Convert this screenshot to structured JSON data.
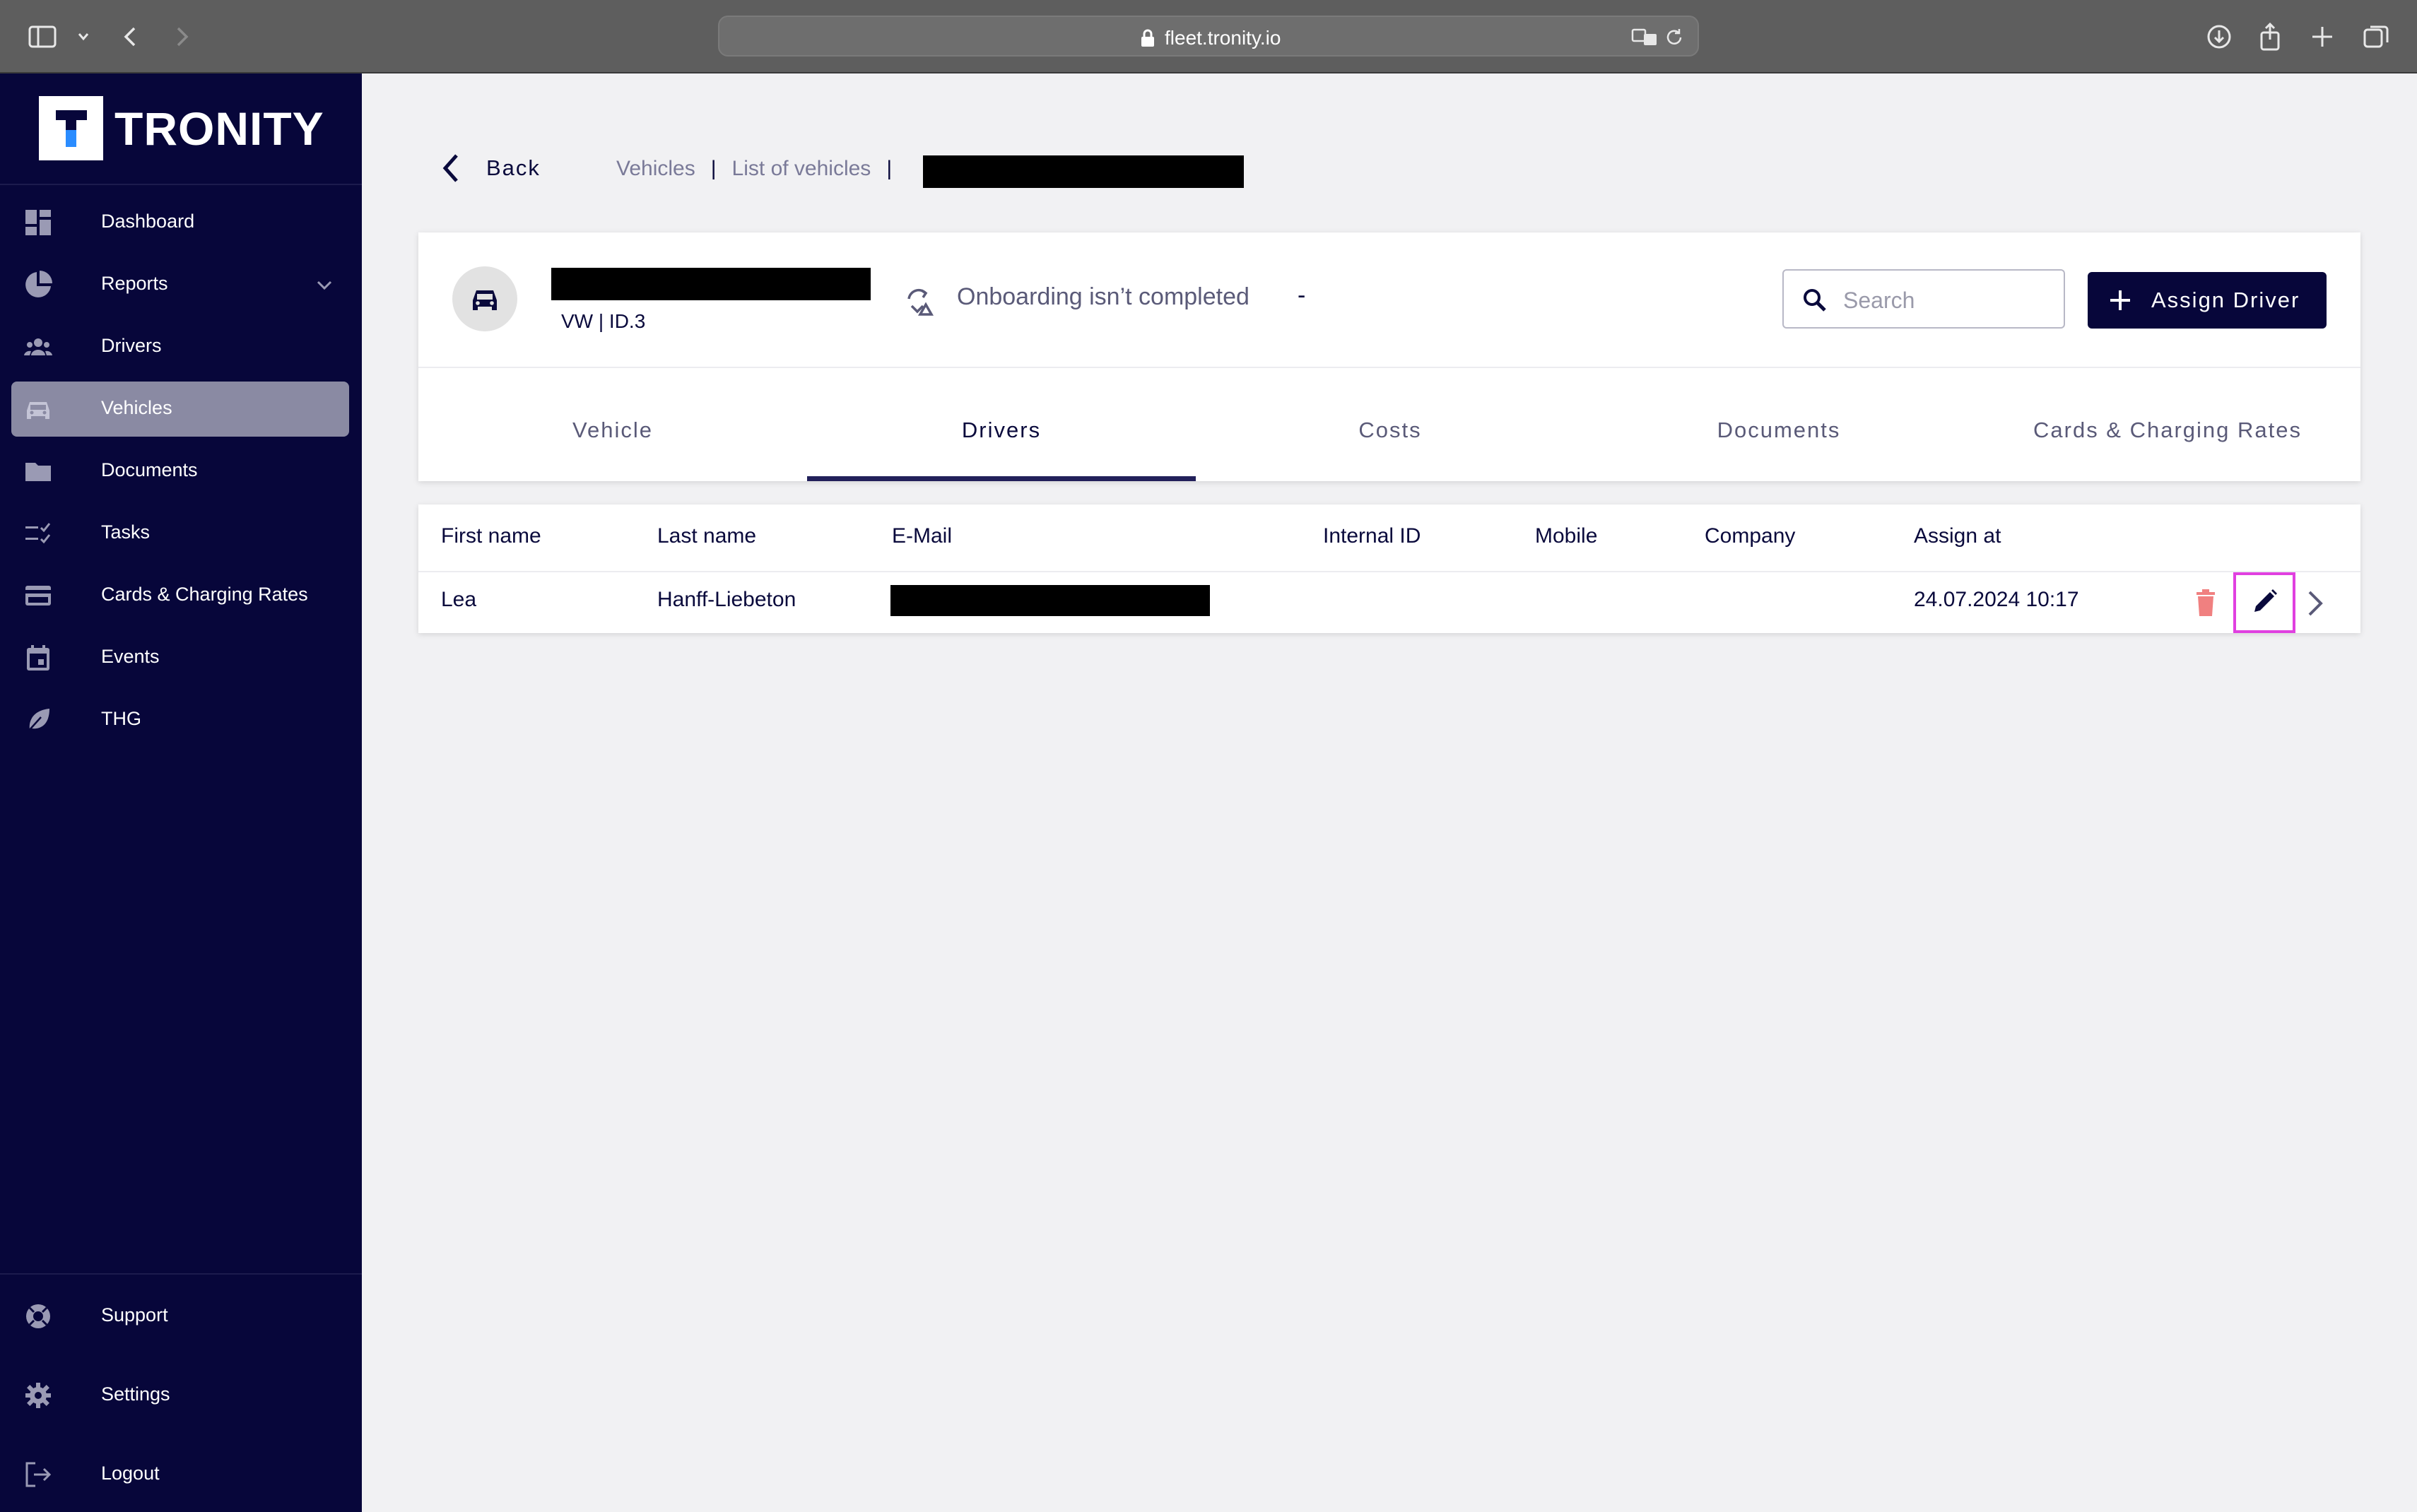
{
  "browser": {
    "url": "fleet.tronity.io",
    "icons": [
      "sidebar-icon",
      "chevron-down-icon",
      "back-arrow-icon",
      "forward-arrow-icon",
      "lock-icon",
      "translate-icon",
      "reload-icon",
      "download-icon",
      "share-icon",
      "new-tab-icon",
      "tabs-overview-icon"
    ]
  },
  "sidebar": {
    "logo_text": "TRONITY",
    "logo_letter": "T",
    "items": [
      {
        "label": "Dashboard",
        "icon": "dashboard-icon"
      },
      {
        "label": "Reports",
        "icon": "pie-chart-icon"
      },
      {
        "label": "Drivers",
        "icon": "people-icon"
      },
      {
        "label": "Vehicles",
        "icon": "car-icon",
        "active": true
      },
      {
        "label": "Documents",
        "icon": "folder-icon"
      },
      {
        "label": "Tasks",
        "icon": "checklist-icon"
      },
      {
        "label": "Cards & Charging Rates",
        "icon": "credit-card-icon"
      },
      {
        "label": "Events",
        "icon": "calendar-icon"
      },
      {
        "label": "THG",
        "icon": "leaf-icon"
      }
    ],
    "bottom_items": [
      {
        "label": "Support",
        "icon": "lifebuoy-icon"
      },
      {
        "label": "Settings",
        "icon": "gear-icon"
      },
      {
        "label": "Logout",
        "icon": "logout-icon"
      }
    ]
  },
  "header": {
    "back_label": "Back",
    "breadcrumbs": [
      "Vehicles",
      "List of vehicles"
    ],
    "breadcrumb_separator": "|"
  },
  "vehicle": {
    "model": "VW | ID.3",
    "onboarding_status": "Onboarding isn’t completed",
    "onboarding_suffix": "-",
    "search_placeholder": "Search",
    "assign_button": "Assign Driver"
  },
  "tabs": [
    {
      "label": "Vehicle"
    },
    {
      "label": "Drivers",
      "active": true
    },
    {
      "label": "Costs"
    },
    {
      "label": "Documents"
    },
    {
      "label": "Cards & Charging Rates"
    }
  ],
  "table": {
    "columns": [
      "First name",
      "Last name",
      "E-Mail",
      "Internal ID",
      "Mobile",
      "Company",
      "Assign at"
    ],
    "rows": [
      {
        "first_name": "Lea",
        "last_name": "Hanff-Liebeton",
        "email": "",
        "internal_id": "",
        "mobile": "",
        "company": "",
        "assign_at": "24.07.2024 10:17"
      }
    ]
  },
  "colors": {
    "sidebar_bg": "#07063a",
    "active_item": "#8a8aa3",
    "accent": "#22205a",
    "delete": "#f08080",
    "highlight": "#e040e0"
  }
}
